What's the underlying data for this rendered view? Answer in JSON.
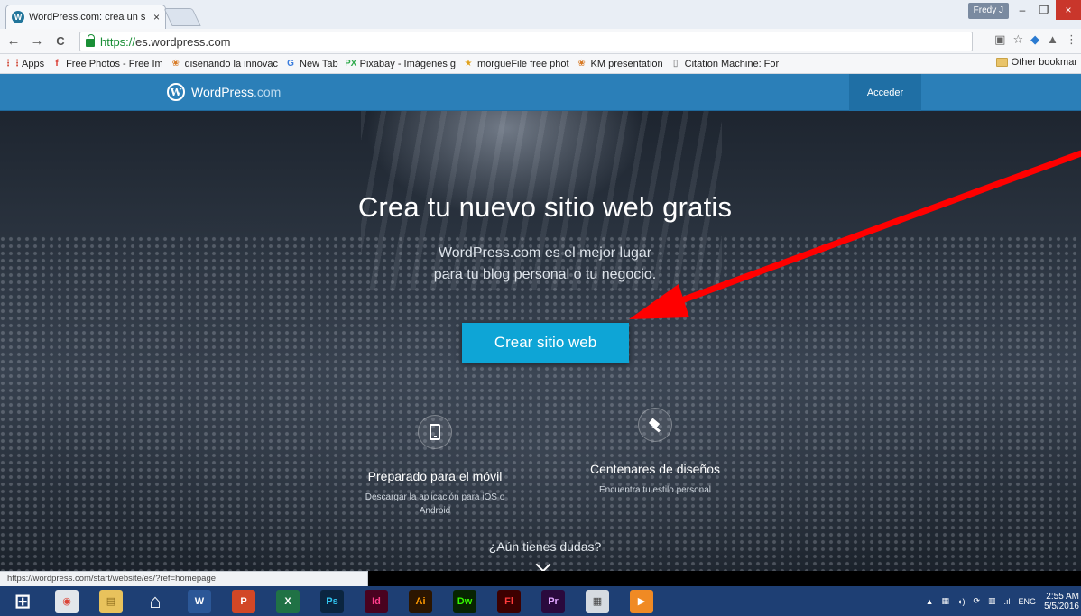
{
  "browser": {
    "tab_title": "WordPress.com: crea un s",
    "tab_close": "×",
    "profile_name": "Fredy J",
    "min_label": "–",
    "max_label": "❐",
    "close_label": "×",
    "url_scheme": "https://",
    "url_host": "es.wordpress.com",
    "back": "←",
    "forward": "→",
    "reload": "C",
    "bookmarks": [
      {
        "label": "Apps",
        "icon": "apps-grid-icon",
        "glyph": "⋮⋮",
        "color": "#d14b3a"
      },
      {
        "label": "Free Photos - Free Im",
        "icon": "f-icon",
        "glyph": "f",
        "color": "#d9342b"
      },
      {
        "label": "disenando la innovac",
        "icon": "leaf-icon",
        "glyph": "❀",
        "color": "#d77a25"
      },
      {
        "label": "New Tab",
        "icon": "google-icon",
        "glyph": "G",
        "color": "#3b7ddd"
      },
      {
        "label": "Pixabay - Imágenes g",
        "icon": "pixabay-icon",
        "glyph": "PX",
        "color": "#2faa4c"
      },
      {
        "label": "morgueFile free phot",
        "icon": "star-icon",
        "glyph": "★",
        "color": "#e0a11b"
      },
      {
        "label": "KM presentation",
        "icon": "leaf-icon",
        "glyph": "❀",
        "color": "#d77a25"
      },
      {
        "label": "Citation Machine: For",
        "icon": "doc-icon",
        "glyph": "▯",
        "color": "#666666"
      }
    ],
    "other_bookmarks": "Other bookmar"
  },
  "site": {
    "brand_name": "WordPress",
    "brand_suffix": ".com",
    "logo_glyph": "W",
    "login": "Acceder",
    "hero_title": "Crea tu nuevo sitio web gratis",
    "hero_sub_line1": "WordPress.com es el mejor lugar",
    "hero_sub_line2": "para tu blog personal o tu negocio.",
    "cta": "Crear sitio web",
    "features": [
      {
        "title": "Preparado para el móvil",
        "desc_line1": "Descargar la aplicación para iOS o",
        "desc_line2": "Android",
        "icon": "mobile-phone-icon"
      },
      {
        "title": "Centenares de diseños",
        "desc_line1": "Encuentra tu estilo personal",
        "desc_line2": "",
        "icon": "hammer-icon"
      }
    ],
    "questions": "¿Aún tienes dudas?"
  },
  "status_bar_url": "https://wordpress.com/start/website/es/?ref=homepage",
  "taskbar": {
    "apps": [
      {
        "name": "windows-start-icon",
        "glyph": "⊞",
        "bg": "#1e3f74",
        "fg": "#ffffff"
      },
      {
        "name": "chrome-icon",
        "glyph": "◉",
        "bg": "#e2e6ea",
        "fg": "#db4437"
      },
      {
        "name": "file-explorer-icon",
        "glyph": "▤",
        "bg": "#e8c25c",
        "fg": "#8a6a1a"
      },
      {
        "name": "home-icon",
        "glyph": "⌂",
        "bg": "#1e3f74",
        "fg": "#ffffff"
      },
      {
        "name": "word-icon",
        "glyph": "W",
        "bg": "#2b5797",
        "fg": "#ffffff"
      },
      {
        "name": "powerpoint-icon",
        "glyph": "P",
        "bg": "#d24726",
        "fg": "#ffffff"
      },
      {
        "name": "excel-icon",
        "glyph": "X",
        "bg": "#207245",
        "fg": "#ffffff"
      },
      {
        "name": "photoshop-icon",
        "glyph": "Ps",
        "bg": "#0b2540",
        "fg": "#31c5f0"
      },
      {
        "name": "indesign-icon",
        "glyph": "Id",
        "bg": "#49021f",
        "fg": "#ff3d8b"
      },
      {
        "name": "illustrator-icon",
        "glyph": "Ai",
        "bg": "#2b1500",
        "fg": "#ff9a00"
      },
      {
        "name": "dreamweaver-icon",
        "glyph": "Dw",
        "bg": "#072401",
        "fg": "#35fa00"
      },
      {
        "name": "flash-icon",
        "glyph": "Fl",
        "bg": "#3c0000",
        "fg": "#ff3a3a"
      },
      {
        "name": "premiere-icon",
        "glyph": "Pr",
        "bg": "#2a0a3d",
        "fg": "#e1a6ff"
      },
      {
        "name": "calculator-icon",
        "glyph": "▦",
        "bg": "#d6dbe1",
        "fg": "#444444"
      },
      {
        "name": "media-player-icon",
        "glyph": "▶",
        "bg": "#f08a24",
        "fg": "#ffffff"
      }
    ],
    "language": "ENG",
    "time": "2:55 AM",
    "date": "5/5/2016"
  },
  "colors": {
    "masthead": "#2b7fb8",
    "cta": "#0ea5d6",
    "annotation_arrow": "#ff0000"
  }
}
